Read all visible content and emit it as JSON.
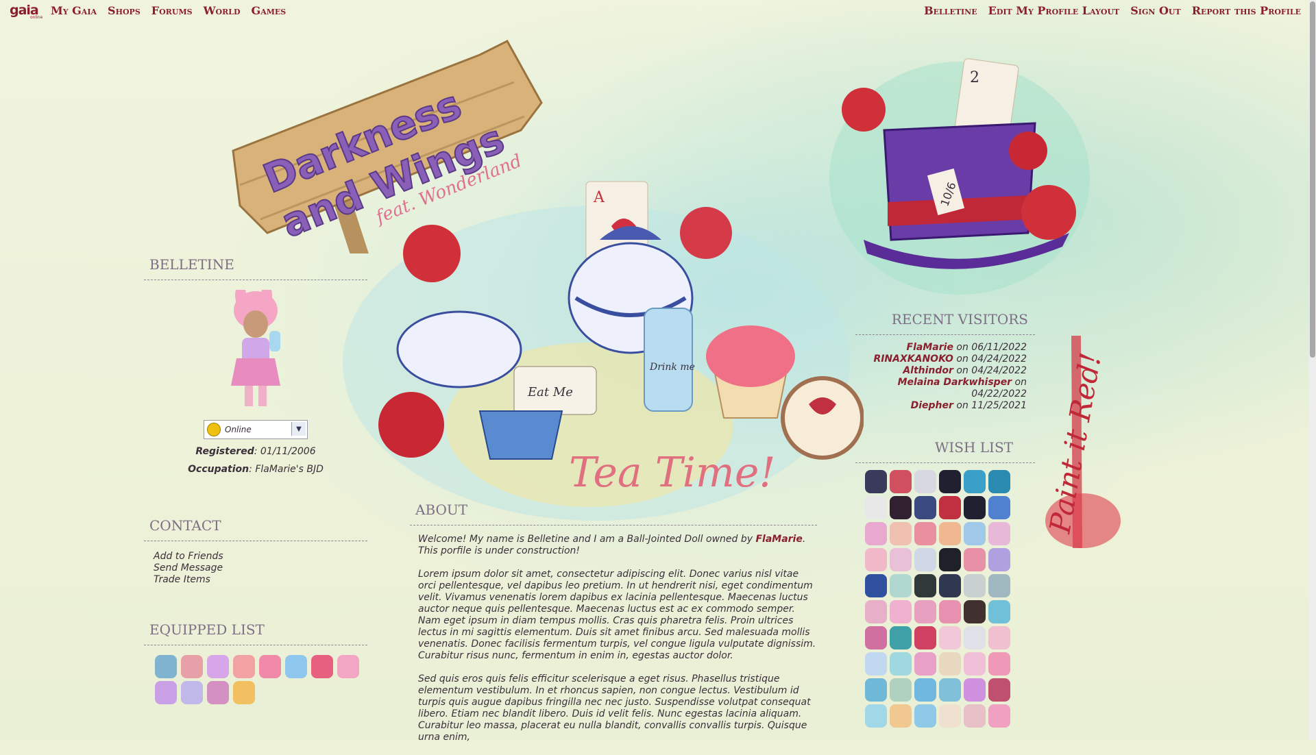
{
  "topnav": {
    "logo": "gaia",
    "logo_sub": "online",
    "left": [
      "My Gaia",
      "Shops",
      "Forums",
      "World",
      "Games"
    ],
    "right": [
      "Belletine",
      "Edit My Profile Layout",
      "Sign Out",
      "Report this Profile"
    ]
  },
  "banner": {
    "sign_title_1": "Darkness",
    "sign_title_2": "and Wings",
    "sign_sub": "feat. Wonderland",
    "tea_caption": "Tea Time!",
    "side_caption": "Paint it Red!",
    "hat_tag": "10/6",
    "card_label": "A",
    "card_label_2": "2",
    "eat_me": "Eat Me",
    "drink_me": "Drink me"
  },
  "profile": {
    "name": "BELLETINE",
    "status": "Online",
    "registered_label": "Registered",
    "registered": "01/11/2006",
    "occupation_label": "Occupation",
    "occupation": "FlaMarie's BJD"
  },
  "contact": {
    "heading": "CONTACT",
    "links": [
      "Add to Friends",
      "Send Message",
      "Trade Items"
    ]
  },
  "equipped": {
    "heading": "EQUIPPED LIST",
    "colors": [
      "#7fb3d0",
      "#e7a0a8",
      "#d7a6e8",
      "#f2a2a2",
      "#f08aa8",
      "#8fc8ee",
      "#e86080",
      "#f3a6c4",
      "#c9a0e6",
      "#c0b8e8",
      "#d490c0",
      "#f2c060"
    ]
  },
  "about": {
    "heading": "ABOUT",
    "intro_1": "Welcome! My name is Belletine and I am a Ball-Jointed Doll owned by ",
    "intro_link": "FlaMarie",
    "intro_2": ".",
    "intro_3": "This porfile is under construction!",
    "p1": "Lorem ipsum dolor sit amet, consectetur adipiscing elit. Donec varius nisl vitae orci pellentesque, vel dapibus leo pretium. In ut hendrerit nisi, eget condimentum velit. Vivamus venenatis lorem dapibus ex lacinia pellentesque. Maecenas luctus auctor neque quis pellentesque. Maecenas luctus est ac ex commodo semper. Nam eget ipsum in diam tempus mollis. Cras quis pharetra felis. Proin ultrices lectus in mi sagittis elementum. Duis sit amet finibus arcu. Sed malesuada mollis venenatis. Donec facilisis fermentum turpis, vel congue ligula vulputate dignissim. Curabitur risus nunc, fermentum in enim in, egestas auctor dolor.",
    "p2": "Sed quis eros quis felis efficitur scelerisque a eget risus. Phasellus tristique elementum vestibulum. In et rhoncus sapien, non congue lectus. Vestibulum id turpis quis augue dapibus fringilla nec nec justo. Suspendisse volutpat consequat libero. Etiam nec blandit libero. Duis id velit felis. Nunc egestas lacinia aliquam. Curabitur leo massa, placerat eu nulla blandit, convallis convallis turpis. Quisque urna enim,"
  },
  "visitors": {
    "heading": "RECENT VISITORS",
    "on": "on",
    "list": [
      {
        "name": "FlaMarie",
        "date": "06/11/2022"
      },
      {
        "name": "RINAXKANOKO",
        "date": "04/24/2022"
      },
      {
        "name": "Althindor",
        "date": "04/24/2022"
      },
      {
        "name": "Melaina Darkwhisper",
        "date": "04/22/2022"
      },
      {
        "name": "Diepher",
        "date": "11/25/2021"
      }
    ]
  },
  "wishlist": {
    "heading": "WISH LIST",
    "colors": [
      "#3a3a5a",
      "#d05060",
      "#d8d8e0",
      "#202030",
      "#3aa0c8",
      "#2a8ab0",
      "#e8e8e8",
      "#302030",
      "#3a4a80",
      "#c03040",
      "#202030",
      "#5080d0",
      "#e8a8d0",
      "#f0c0b0",
      "#e890a0",
      "#f0b890",
      "#a0c8e8",
      "#e8b8d8",
      "#f0b8c8",
      "#e8c0d8",
      "#d0d8e8",
      "#202028",
      "#e890a8",
      "#b0a0e0",
      "#3050a0",
      "#b0d8d0",
      "#303838",
      "#303850",
      "#c8d0d0",
      "#a0b8c0",
      "#e8b0c8",
      "#f0b0d0",
      "#e8a0c0",
      "#e890b0",
      "#403030",
      "#70c0d8",
      "#d070a0",
      "#40a0a8",
      "#d04060",
      "#f0c8d8",
      "#e0e0e8",
      "#f0c0d0",
      "#c0d8f0",
      "#a0d8e0",
      "#e8a0c8",
      "#e8d8c0",
      "#f0c0d8",
      "#f098b8",
      "#70b8d8",
      "#b0d0c0",
      "#70b8e0",
      "#80c0d8",
      "#d090e0",
      "#c05070",
      "#a0d8e8",
      "#f0c890",
      "#90c8e8",
      "#f0e0d0",
      "#e8c0c8",
      "#f0a0c0"
    ]
  }
}
